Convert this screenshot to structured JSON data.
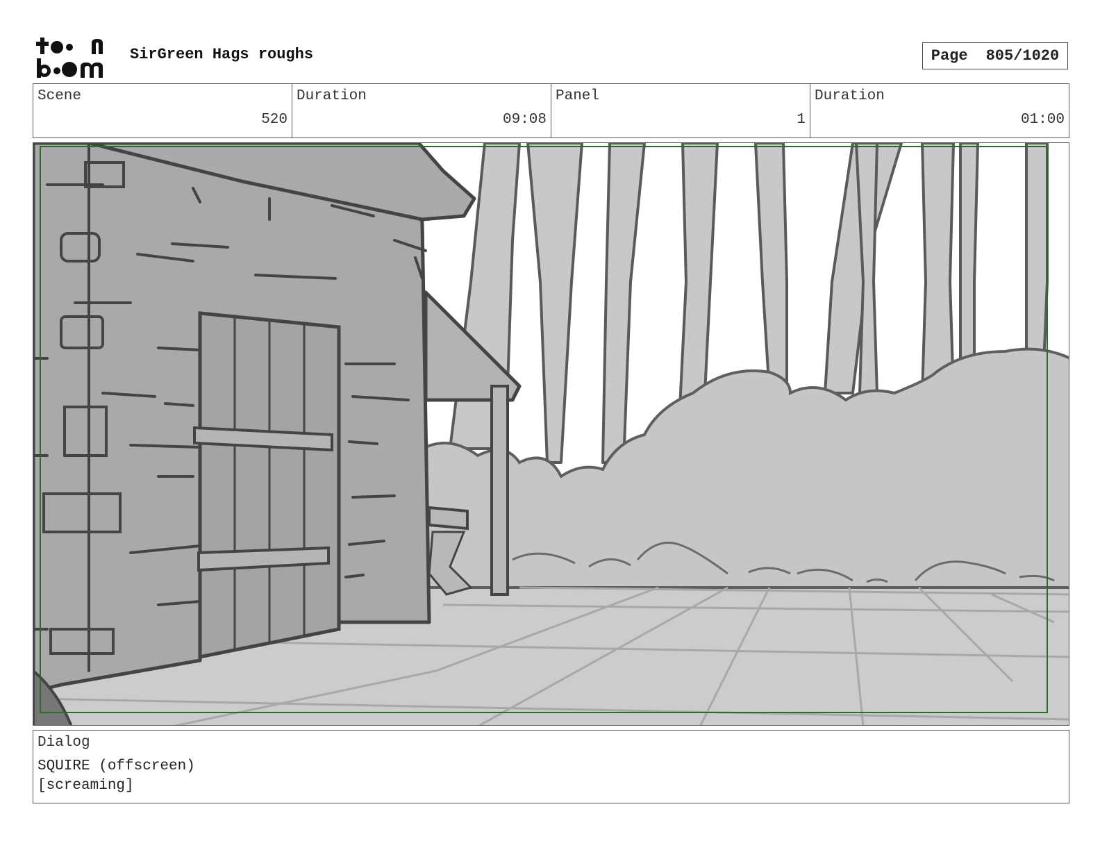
{
  "header": {
    "logo_text": "toon boom",
    "project_title": "SirGreen Hags roughs",
    "page_label": "Page",
    "page_value": "805/1020"
  },
  "info": {
    "scene_label": "Scene",
    "scene_value": "520",
    "scene_duration_label": "Duration",
    "scene_duration_value": "09:08",
    "panel_label": "Panel",
    "panel_value": "1",
    "panel_duration_label": "Duration",
    "panel_duration_value": "01:00"
  },
  "dialog": {
    "label": "Dialog",
    "line1": "SQUIRE (offscreen)",
    "line2": "[screaming]"
  },
  "colors": {
    "frame_green": "#2e6b2a",
    "sketch_line": "#4a4a4a",
    "light_fill": "#cfcfcf",
    "mid_fill": "#b3b3b3"
  }
}
